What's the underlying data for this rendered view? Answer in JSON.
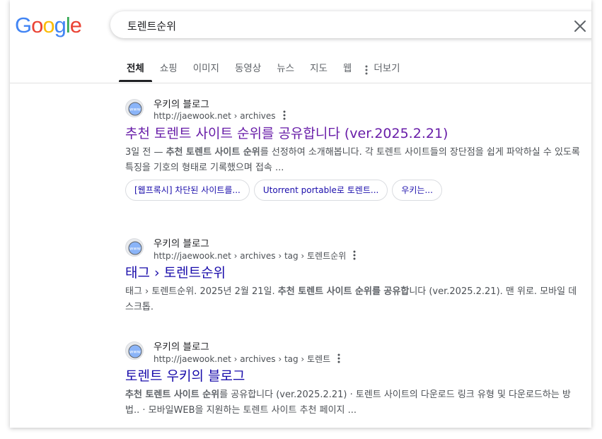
{
  "logo": {
    "letters": [
      "G",
      "o",
      "o",
      "g",
      "l",
      "e"
    ],
    "colors": [
      "#4285F4",
      "#EA4335",
      "#FBBC05",
      "#4285F4",
      "#34A853",
      "#EA4335"
    ]
  },
  "search": {
    "query": "토렌트순위"
  },
  "tabs": [
    {
      "label": "전체",
      "active": true
    },
    {
      "label": "쇼핑"
    },
    {
      "label": "이미지"
    },
    {
      "label": "동영상"
    },
    {
      "label": "뉴스"
    },
    {
      "label": "지도"
    },
    {
      "label": "웹"
    },
    {
      "label": "더보기"
    }
  ],
  "results": [
    {
      "site": "우키의 블로그",
      "url": "http://jaewook.net › archives",
      "title": "추천 토렌트 사이트 순위를 공유합니다 (ver.2025.2.21)",
      "snippet_pre": "3일 전 — ",
      "snippet_bold": "추천 토렌트 사이트 순위",
      "snippet_post": "를 선정하여 소개해봅니다. 각 토렌트 사이트들의 장단점을 쉽게 파악하실 수 있도록 특징을 기호의 형태로 기록했으며 접속 ...",
      "chips": [
        "[웹프록시] 차단된 사이트를...",
        "Utorrent portable로 토렌트...",
        "우키는..."
      ]
    },
    {
      "site": "우키의 블로그",
      "url": "http://jaewook.net › archives › tag › 토렌트순위",
      "title": "태그 › 토렌트순위",
      "snippet_pre": "태그 › 토렌트순위. 2025년 2월 21일. ",
      "snippet_bold": "추천 토렌트 사이트 순위를 공유합",
      "snippet_post": "니다 (ver.2025.2.21). 맨 위로. 모바일 데스크톱."
    },
    {
      "site": "우키의 블로그",
      "url": "http://jaewook.net › archives › tag › 토렌트",
      "title": "토렌트 우키의 블로그",
      "snippet_pre": "",
      "snippet_bold": "추천 토렌트 사이트 순위",
      "snippet_post": "를 공유합니다 (ver.2025.2.21) · 토렌트 사이트의 다운로드 링크 유형 및 다운로드하는 방법.. · 모바일WEB을 지원하는 토렌트 사이트 추천 페이지 ..."
    }
  ],
  "colors": {
    "link": "#1a0dab",
    "visited": "#681da8",
    "snippet": "#4d5156"
  }
}
